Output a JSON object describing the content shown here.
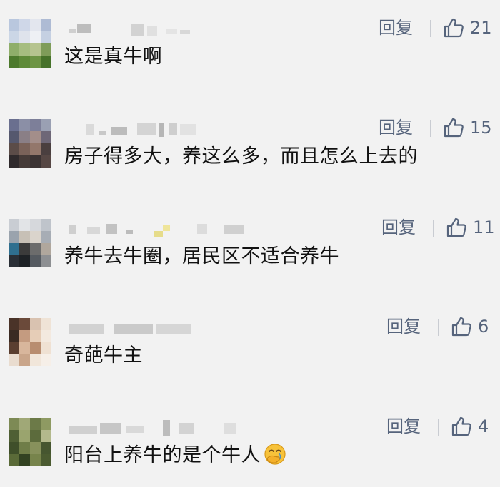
{
  "comments": [
    {
      "text": "这是真牛啊",
      "reply_label": "回复",
      "like_count": "21",
      "avatar_icon": "avatar-blurred-sky-grass",
      "avatar_colors": [
        "#b9c7de",
        "#cfd7e8",
        "#e3e6ee",
        "#aebbd4",
        "#cbd6e6",
        "#dfe3ec",
        "#eef0f4",
        "#c5d0e2",
        "#8fae6a",
        "#a6bd80",
        "#b6c48f",
        "#7e9c59",
        "#4d7a2d",
        "#5e8a38",
        "#6d9444",
        "#46722a"
      ]
    },
    {
      "text": "房子得多大，养这么多，而且怎么上去的",
      "reply_label": "回复",
      "like_count": "15",
      "avatar_icon": "avatar-blurred-crowd",
      "avatar_colors": [
        "#6a6f8f",
        "#8b8fa6",
        "#7d7f99",
        "#9aa0b3",
        "#55586e",
        "#8a7f86",
        "#a38e8a",
        "#6e6777",
        "#5b4c48",
        "#7a6259",
        "#93776b",
        "#4a3f3f",
        "#2f2a2c",
        "#463b38",
        "#3b3333",
        "#564744"
      ]
    },
    {
      "text": "养牛去牛圈，居民区不适合养牛",
      "reply_label": "回复",
      "like_count": "11",
      "avatar_icon": "avatar-blurred-street",
      "avatar_colors": [
        "#c9cdd3",
        "#e2e4e7",
        "#d6d8dc",
        "#bfc4cb",
        "#9aa3ad",
        "#c7c0b6",
        "#dad4cc",
        "#a7adb5",
        "#2f6f8f",
        "#3b3b3b",
        "#6c6c6c",
        "#b0a79d",
        "#2a2f36",
        "#1e2226",
        "#555a60",
        "#8d8f92"
      ]
    },
    {
      "text": "奇葩牛主",
      "reply_label": "回复",
      "like_count": "6",
      "avatar_icon": "avatar-blurred-person",
      "avatar_colors": [
        "#4a3328",
        "#6b4a3a",
        "#d9c2b0",
        "#efe3d6",
        "#3a2a22",
        "#c49b80",
        "#e6cdb7",
        "#f3e9df",
        "#5a3e30",
        "#d8b69c",
        "#b88d70",
        "#efe1d3",
        "#e9dccf",
        "#c9a58a",
        "#f1e6da",
        "#f6efe8"
      ]
    },
    {
      "text": "阳台上养牛的是个牛人",
      "reply_label": "回复",
      "like_count": "4",
      "avatar_icon": "avatar-blurred-foliage",
      "avatar_colors": [
        "#7d8a55",
        "#a0a877",
        "#6c7a48",
        "#8e9a62",
        "#4f5f34",
        "#9aa46e",
        "#5c6b3c",
        "#b3b98c",
        "#3f4f2a",
        "#6f7d48",
        "#87915c",
        "#465630",
        "#5a6a38",
        "#324222",
        "#77844c",
        "#4b5b31"
      ],
      "emoji": "face-with-hand-over-mouth-emoji"
    }
  ]
}
